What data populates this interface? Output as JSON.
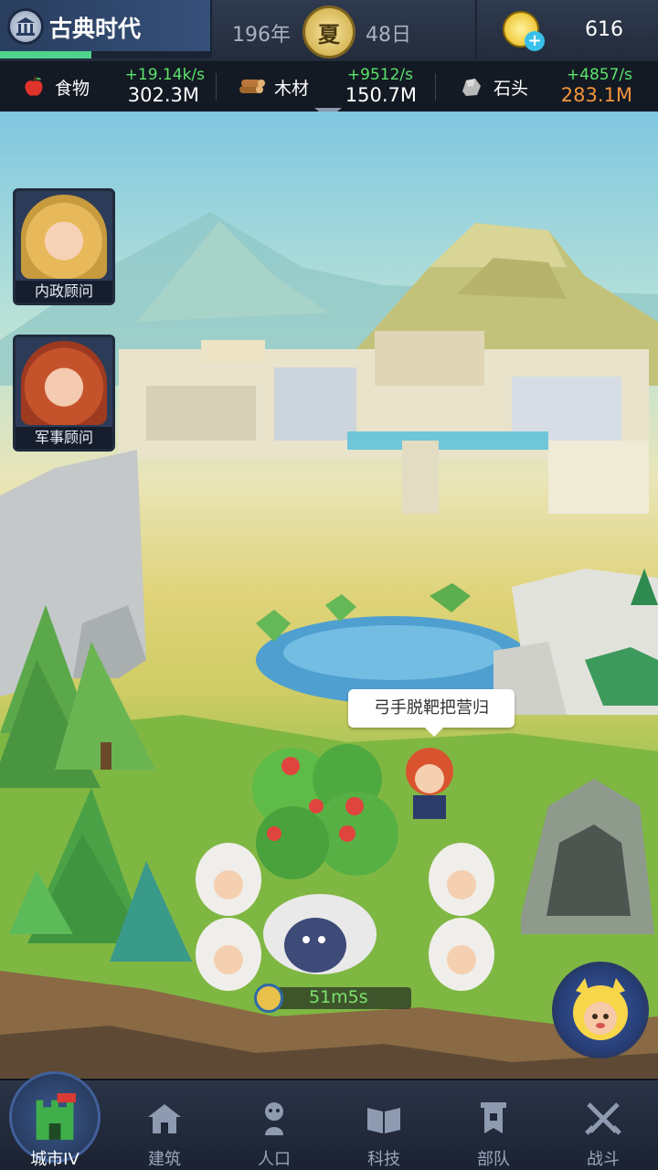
{
  "header": {
    "era_title": "古典时代",
    "era_progress_fraction": 0.43,
    "year": "196年",
    "season": "夏",
    "day": "48日",
    "gold": "616",
    "colors": {
      "progress": "#4fd28c",
      "rate": "#5be36a",
      "warning": "#f2953c"
    }
  },
  "resources": [
    {
      "name": "食物",
      "icon": "apple-icon",
      "rate": "+19.14k/s",
      "amount": "302.3M",
      "warning": false
    },
    {
      "name": "木材",
      "icon": "logs-icon",
      "rate": "+9512/s",
      "amount": "150.7M",
      "warning": false
    },
    {
      "name": "石头",
      "icon": "stone-icon",
      "rate": "+4857/s",
      "amount": "283.1M",
      "warning": true
    }
  ],
  "advisors": [
    {
      "label": "内政顾问"
    },
    {
      "label": "军事顾问"
    }
  ],
  "scene": {
    "speech": "弓手脱靶把营归",
    "timer": "51m5s"
  },
  "nav": {
    "items": [
      {
        "label": "城市IV",
        "icon": "castle-icon",
        "active": true
      },
      {
        "label": "建筑",
        "icon": "house-icon",
        "active": false
      },
      {
        "label": "人口",
        "icon": "person-icon",
        "active": false
      },
      {
        "label": "科技",
        "icon": "book-icon",
        "active": false
      },
      {
        "label": "部队",
        "icon": "banner-icon",
        "active": false
      },
      {
        "label": "战斗",
        "icon": "crossed-swords-icon",
        "active": false
      }
    ]
  }
}
